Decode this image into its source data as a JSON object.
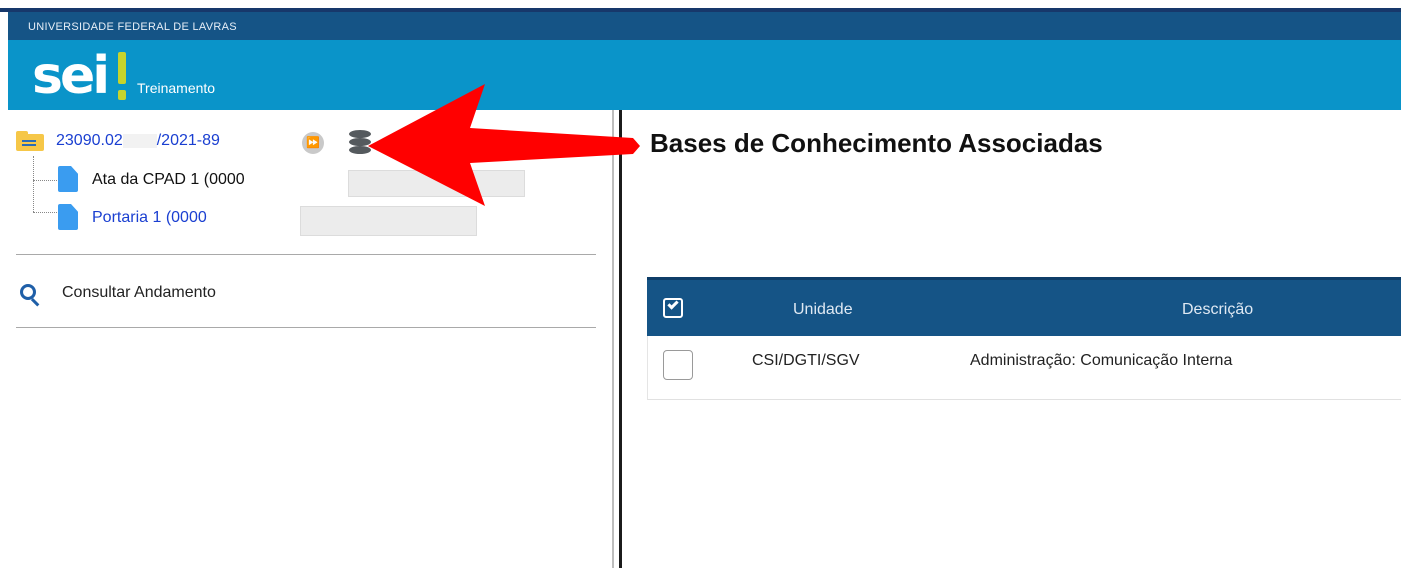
{
  "header": {
    "organization": "UNIVERSIDADE FEDERAL DE LAVRAS",
    "logo_text": "sei",
    "environment": "Treinamento"
  },
  "tree": {
    "process_number_start": "23090.02",
    "process_number_end": "/2021-89",
    "documents": [
      {
        "label": "Ata da CPAD 1 (0000",
        "color": "black"
      },
      {
        "label": "Portaria 1 (0000",
        "color": "blue"
      }
    ],
    "icons": [
      "folder-icon",
      "fast-forward-icon",
      "database-icon",
      "document-icon"
    ]
  },
  "menu": {
    "consult_label": "Consultar Andamento"
  },
  "main": {
    "title": "Bases de Conhecimento Associadas",
    "table": {
      "columns": [
        "Unidade",
        "Descrição"
      ],
      "rows": [
        {
          "unidade": "CSI/DGTI/SGV",
          "descricao": "Administração: Comunicação Interna"
        }
      ]
    }
  },
  "colors": {
    "org_bar": "#155486",
    "main_bar": "#0a94c9",
    "logo_accent": "#c7d42c",
    "link_blue": "#1a3fd1",
    "annotation_arrow": "#ff0000"
  }
}
